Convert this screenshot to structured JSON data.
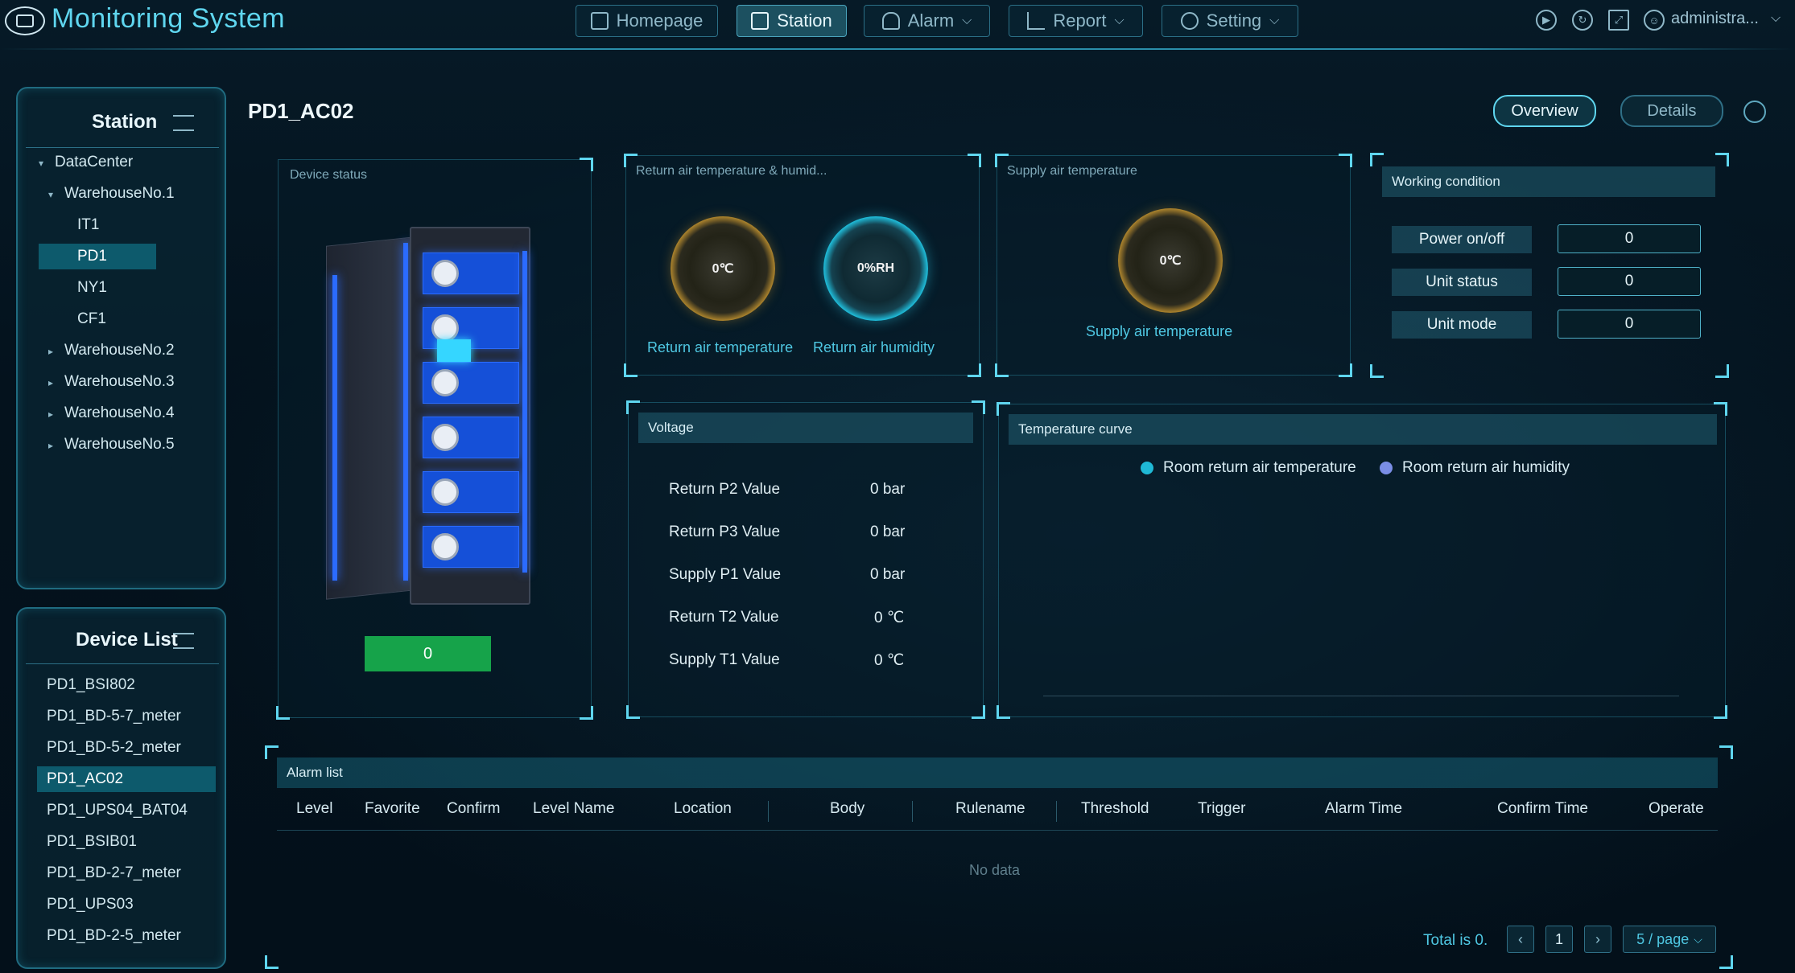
{
  "app": {
    "title": "Monitoring System"
  },
  "nav": [
    {
      "label": "Homepage",
      "icon": "grid-icon",
      "dropdown": false,
      "active": false
    },
    {
      "label": "Station",
      "icon": "station-icon",
      "dropdown": false,
      "active": true
    },
    {
      "label": "Alarm",
      "icon": "bell-icon",
      "dropdown": true,
      "active": false
    },
    {
      "label": "Report",
      "icon": "bar-chart-icon",
      "dropdown": true,
      "active": false
    },
    {
      "label": "Setting",
      "icon": "gear-icon",
      "dropdown": true,
      "active": false
    }
  ],
  "user": {
    "name": "administra..."
  },
  "station_panel": {
    "title": "Station",
    "tree": [
      {
        "label": "DataCenter",
        "caret": "▾"
      },
      {
        "label": "WarehouseNo.1",
        "caret": "▾"
      },
      {
        "label": "IT1",
        "caret": ""
      },
      {
        "label": "PD1",
        "caret": "",
        "selected": true
      },
      {
        "label": "NY1",
        "caret": ""
      },
      {
        "label": "CF1",
        "caret": ""
      },
      {
        "label": "WarehouseNo.2",
        "caret": "▸"
      },
      {
        "label": "WarehouseNo.3",
        "caret": "▸"
      },
      {
        "label": "WarehouseNo.4",
        "caret": "▸"
      },
      {
        "label": "WarehouseNo.5",
        "caret": "▸"
      }
    ]
  },
  "device_panel": {
    "title": "Device List",
    "items": [
      {
        "label": "PD1_BSI802"
      },
      {
        "label": "PD1_BD-5-7_meter"
      },
      {
        "label": "PD1_BD-5-2_meter"
      },
      {
        "label": "PD1_AC02",
        "selected": true
      },
      {
        "label": "PD1_UPS04_BAT04"
      },
      {
        "label": "PD1_BSIB01"
      },
      {
        "label": "PD1_BD-2-7_meter"
      },
      {
        "label": "PD1_UPS03"
      },
      {
        "label": "PD1_BD-2-5_meter"
      }
    ]
  },
  "page": {
    "title": "PD1_AC02",
    "overview_label": "Overview",
    "details_label": "Details"
  },
  "device_status": {
    "label": "Device status",
    "value": "0",
    "status_color": "#16a34a"
  },
  "return_air": {
    "label": "Return air temperature & humid...",
    "temp_value": "0℃",
    "humidity_value": "0%RH",
    "temp_caption": "Return air temperature",
    "humidity_caption": "Return air humidity"
  },
  "supply_air": {
    "label": "Supply air temperature",
    "temp_value": "0℃",
    "caption": "Supply air temperature"
  },
  "working_condition": {
    "title": "Working condition",
    "rows": [
      {
        "label": "Power on/off",
        "value": "0"
      },
      {
        "label": "Unit status",
        "value": "0"
      },
      {
        "label": "Unit mode",
        "value": "0"
      }
    ]
  },
  "voltage": {
    "title": "Voltage",
    "rows": [
      {
        "label": "Return P2 Value",
        "value": "0",
        "unit": "bar"
      },
      {
        "label": "Return P3 Value",
        "value": "0",
        "unit": "bar"
      },
      {
        "label": "Supply P1 Value",
        "value": "0",
        "unit": "bar"
      },
      {
        "label": "Return T2 Value",
        "value": "0",
        "unit": "℃"
      },
      {
        "label": "Supply T1 Value",
        "value": "0",
        "unit": "℃"
      }
    ]
  },
  "temperature_curve": {
    "title": "Temperature curve",
    "legend": [
      {
        "label": "Room return air temperature",
        "color": "#1fb9d6"
      },
      {
        "label": "Room return air humidity",
        "color": "#7a8ee6"
      }
    ]
  },
  "alarm_list": {
    "title": "Alarm list",
    "columns": [
      "Level",
      "Favorite",
      "Confirm",
      "Level Name",
      "Location",
      "Body",
      "Rulename",
      "Threshold",
      "Trigger",
      "Alarm Time",
      "Confirm Time",
      "Operate"
    ],
    "empty_text": "No data",
    "total_text": "Total is 0.",
    "current_page": "1",
    "page_size": "5 / page"
  },
  "colors": {
    "accent": "#5fd6ef",
    "background": "#04121d",
    "selected": "#0d5a6c"
  }
}
